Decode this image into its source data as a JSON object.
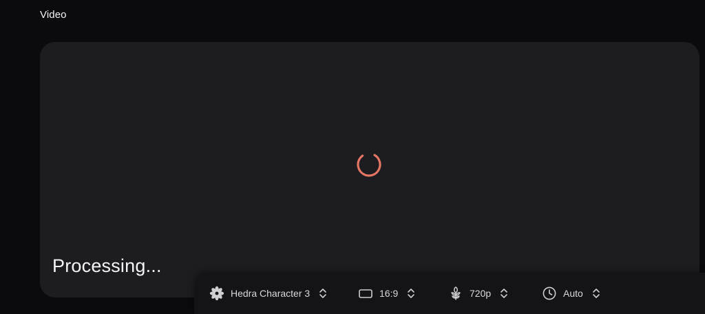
{
  "section": {
    "title": "Video"
  },
  "video_panel": {
    "status_text": "Processing...",
    "spinner_color": "#e57663"
  },
  "toolbar": {
    "model": {
      "label": "Hedra Character 3",
      "icon": "flower-icon"
    },
    "aspect_ratio": {
      "label": "16:9",
      "icon": "rectangle-icon"
    },
    "resolution": {
      "label": "720p",
      "icon": "plant-icon"
    },
    "duration": {
      "label": "Auto",
      "icon": "clock-icon"
    }
  }
}
